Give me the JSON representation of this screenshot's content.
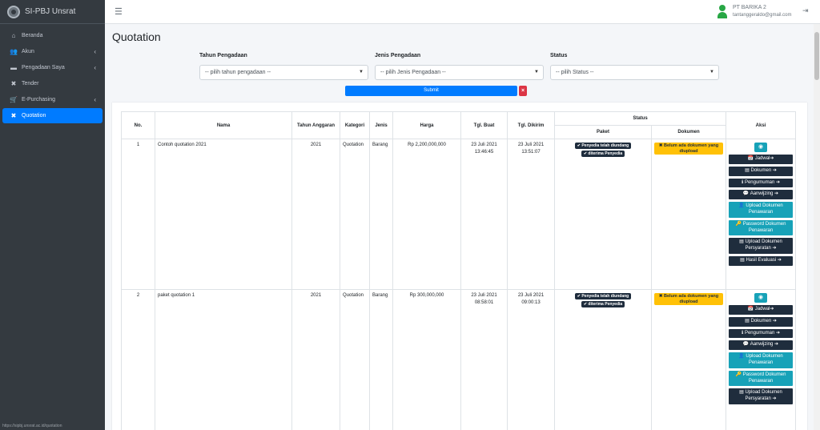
{
  "app": {
    "brand": "SI-PBJ Unsrat",
    "status_url": "https://sipbj.unsrat.ac.id/quotation"
  },
  "sidebar": {
    "items": [
      {
        "label": "Beranda",
        "icon": "home-icon"
      },
      {
        "label": "Akun",
        "icon": "users-icon"
      },
      {
        "label": "Pengadaan Saya",
        "icon": "folder-icon"
      },
      {
        "label": "Tender",
        "icon": "tools-icon"
      },
      {
        "label": "E-Purchasing",
        "icon": "cart-icon"
      },
      {
        "label": "Quotation",
        "icon": "tools-icon"
      }
    ]
  },
  "header": {
    "user_name": "PT BARIKA 2",
    "user_email": "tantanggeraldo@gmail.com"
  },
  "page": {
    "title": "Quotation"
  },
  "filters": {
    "tahun": {
      "label": "Tahun Pengadaan",
      "value": "-- pilih tahun pengadaan --"
    },
    "jenis": {
      "label": "Jenis Pengadaan",
      "value": "-- pilih Jenis Pengadaan --"
    },
    "status": {
      "label": "Status",
      "value": "-- pilih Status --"
    },
    "submit_label": "Submit",
    "clear_label": "×"
  },
  "table": {
    "headers": {
      "no": "No.",
      "nama": "Nama",
      "tahun": "Tahun Anggaran",
      "kategori": "Kategori",
      "jenis": "Jenis",
      "harga": "Harga",
      "tgl_buat": "Tgl. Buat",
      "tgl_dikirim": "Tgl. Dikirim",
      "status": "Status",
      "paket": "Paket",
      "dokumen": "Dokumen",
      "aksi": "Aksi"
    },
    "rows": [
      {
        "no": "1",
        "nama": "Contoh quotation 2021",
        "tahun": "2021",
        "kategori": "Quotation",
        "jenis": "Barang",
        "harga": "Rp 2,200,000,000",
        "tgl_buat": "23 Juli 2021",
        "jam_buat": "13:46:45",
        "tgl_dikirim": "23 Juli 2021",
        "jam_dikirim": "13:51:07",
        "paket_1": "✔ Penyedia telah diundang",
        "paket_2": "✔ diterima Penyedia",
        "dokumen": "✖ Belum ada dokumen yang diupload"
      },
      {
        "no": "2",
        "nama": "paket quotation 1",
        "tahun": "2021",
        "kategori": "Quotation",
        "jenis": "Barang",
        "harga": "Rp 300,000,000",
        "tgl_buat": "23 Juli 2021",
        "jam_buat": "08:58:01",
        "tgl_dikirim": "23 Juli 2021",
        "jam_dikirim": "09:00:13",
        "paket_1": "✔ Penyedia telah diundang",
        "paket_2": "✔ diterima Penyedia",
        "dokumen": "✖ Belum ada dokumen yang diupload"
      }
    ],
    "actions": {
      "jadwal": "📅 Jadwal➔",
      "dokumen": "▤ Dokumen ➔",
      "pengumuman": "ℹ Pengumuman ➔",
      "aanwijzing": "💬 Aanwijzing ➔",
      "upload_penawaran": "👤 Upload Dokumen Penawaran",
      "password_penawaran": "🔑 Password Dokumen Penawaran",
      "upload_persyaratan": "▤ Upload Dokumen Persyaratan ➔",
      "hasil_evaluasi": "▤ Hasil Evaluasi ➔"
    }
  },
  "colors": {
    "primary": "#007bff",
    "danger": "#dc3545",
    "warning": "#ffc107",
    "info": "#17a2b8",
    "dark": "#1f2d3d",
    "sidebar": "#343a40"
  }
}
